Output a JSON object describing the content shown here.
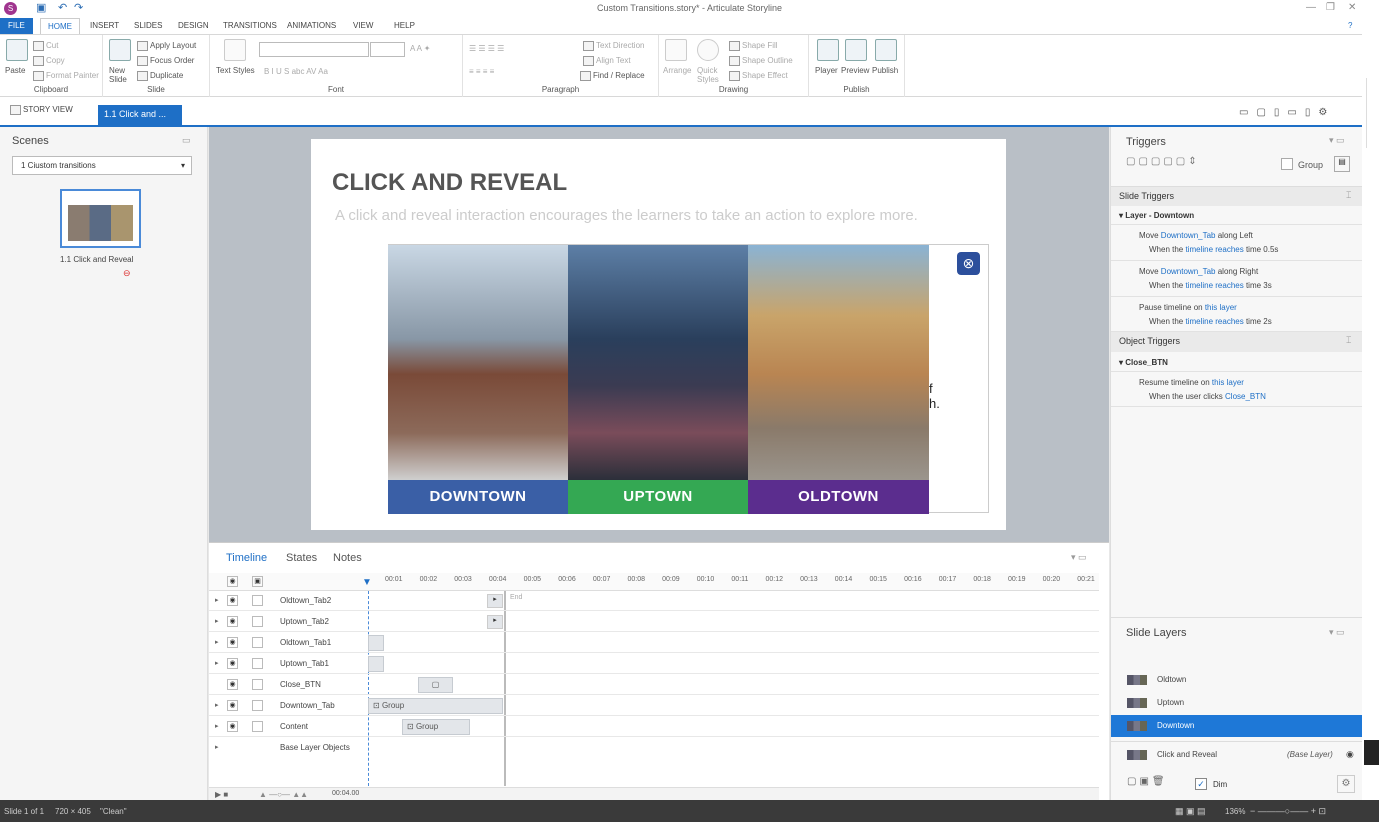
{
  "titlebar": {
    "title": "Custom Transitions.story* - Articulate Storyline",
    "logo": "S"
  },
  "menu": [
    "FILE",
    "HOME",
    "INSERT",
    "SLIDES",
    "DESIGN",
    "TRANSITIONS",
    "ANIMATIONS",
    "VIEW",
    "HELP"
  ],
  "ribbon": {
    "clipboard": {
      "paste": "Paste",
      "cut": "Cut",
      "copy": "Copy",
      "format_painter": "Format Painter",
      "label": "Clipboard"
    },
    "slide": {
      "new_slide": "New Slide",
      "apply_layout": "Apply Layout",
      "focus_order": "Focus Order",
      "duplicate": "Duplicate",
      "label": "Slide"
    },
    "font": {
      "text_styles": "Text Styles",
      "label": "Font",
      "buttons": "B  I  U  S  abc  AV  Aa"
    },
    "paragraph": {
      "text_direction": "Text Direction",
      "align_text": "Align Text",
      "find_replace": "Find / Replace",
      "label": "Paragraph"
    },
    "drawing": {
      "arrange": "Arrange",
      "quick_styles": "Quick Styles",
      "shape_fill": "Shape Fill",
      "shape_outline": "Shape Outline",
      "shape_effect": "Shape Effect",
      "label": "Drawing"
    },
    "publish": {
      "player": "Player",
      "preview": "Preview",
      "publish": "Publish",
      "label": "Publish"
    }
  },
  "tabs": {
    "story_view": "STORY VIEW",
    "slide_tab": "1.1 Click and ..."
  },
  "scenes": {
    "header": "Scenes",
    "selected": "1 Ciustom transitions",
    "thumb_label": "1.1 Click and Reveal"
  },
  "slide": {
    "title": "CLICK AND REVEAL",
    "subtitle": "A click and reveal interaction encourages the learners to take an action to explore more.",
    "fragment": "f\nh.",
    "tabs": [
      {
        "label": "DOWNTOWN",
        "color": "#3a5fa6"
      },
      {
        "label": "UPTOWN",
        "color": "#34a853"
      },
      {
        "label": "OLDTOWN",
        "color": "#5b2d8e"
      }
    ]
  },
  "timeline": {
    "tabs": [
      "Timeline",
      "States",
      "Notes"
    ],
    "ticks": [
      "00:01",
      "00:02",
      "00:03",
      "00:04",
      "00:05",
      "00:06",
      "00:07",
      "00:08",
      "00:09",
      "00:10",
      "00:11",
      "00:12",
      "00:13",
      "00:14",
      "00:15",
      "00:16",
      "00:17",
      "00:18",
      "00:19",
      "00:20",
      "00:21"
    ],
    "end_label": "End",
    "rows": [
      {
        "name": "Oldtown_Tab2"
      },
      {
        "name": "Uptown_Tab2"
      },
      {
        "name": "Oldtown_Tab1"
      },
      {
        "name": "Uptown_Tab1"
      },
      {
        "name": "Close_BTN"
      },
      {
        "name": "Downtown_Tab",
        "bar": "Group"
      },
      {
        "name": "Content",
        "bar": "Group"
      },
      {
        "name": "Base Layer Objects"
      }
    ],
    "playhead_time": "00:04.00"
  },
  "triggers": {
    "header": "Triggers",
    "group_label": "Group",
    "slide_triggers": "Slide Triggers",
    "layer_name": "Layer - Downtown",
    "items": [
      {
        "a": "Move ",
        "b": "Downtown_Tab",
        "c": " along Left",
        "w1": "When the ",
        "w2": "timeline reaches",
        "w3": " time 0.5s"
      },
      {
        "a": "Move ",
        "b": "Downtown_Tab",
        "c": " along Right",
        "w1": "When the ",
        "w2": "timeline reaches",
        "w3": " time 3s"
      },
      {
        "a": "Pause timeline on ",
        "b": "this layer",
        "c": "",
        "w1": "When the ",
        "w2": "timeline reaches",
        "w3": " time 2s"
      }
    ],
    "object_triggers": "Object Triggers",
    "object_name": "Close_BTN",
    "object_item": {
      "a": "Resume timeline on ",
      "b": "this layer",
      "w1": "When the user clicks ",
      "w2": "Close_BTN"
    }
  },
  "layers": {
    "header": "Slide Layers",
    "items": [
      "Oldtown",
      "Uptown",
      "Downtown"
    ],
    "base": "Click and Reveal",
    "base_tag": "(Base Layer)",
    "dim": "Dim"
  },
  "status": {
    "slide": "Slide 1 of 1",
    "size": "720 × 405",
    "theme": "\"Clean\"",
    "zoom": "136%"
  }
}
